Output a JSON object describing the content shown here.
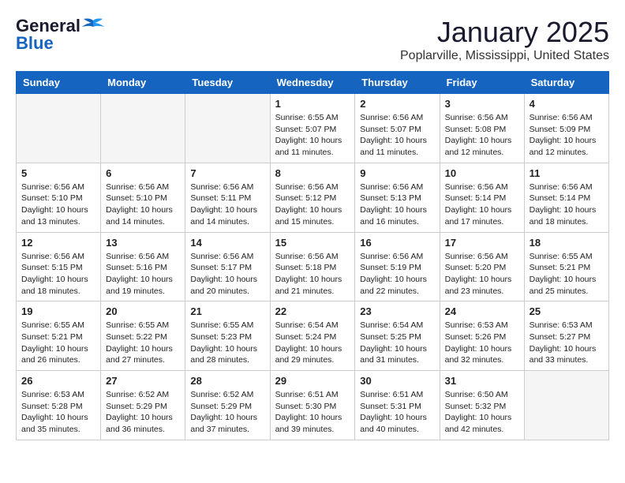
{
  "header": {
    "logo_general": "General",
    "logo_blue": "Blue",
    "title": "January 2025",
    "subtitle": "Poplarville, Mississippi, United States"
  },
  "days_of_week": [
    "Sunday",
    "Monday",
    "Tuesday",
    "Wednesday",
    "Thursday",
    "Friday",
    "Saturday"
  ],
  "weeks": [
    [
      {
        "day": "",
        "info": ""
      },
      {
        "day": "",
        "info": ""
      },
      {
        "day": "",
        "info": ""
      },
      {
        "day": "1",
        "info": "Sunrise: 6:55 AM\nSunset: 5:07 PM\nDaylight: 10 hours\nand 11 minutes."
      },
      {
        "day": "2",
        "info": "Sunrise: 6:56 AM\nSunset: 5:07 PM\nDaylight: 10 hours\nand 11 minutes."
      },
      {
        "day": "3",
        "info": "Sunrise: 6:56 AM\nSunset: 5:08 PM\nDaylight: 10 hours\nand 12 minutes."
      },
      {
        "day": "4",
        "info": "Sunrise: 6:56 AM\nSunset: 5:09 PM\nDaylight: 10 hours\nand 12 minutes."
      }
    ],
    [
      {
        "day": "5",
        "info": "Sunrise: 6:56 AM\nSunset: 5:10 PM\nDaylight: 10 hours\nand 13 minutes."
      },
      {
        "day": "6",
        "info": "Sunrise: 6:56 AM\nSunset: 5:10 PM\nDaylight: 10 hours\nand 14 minutes."
      },
      {
        "day": "7",
        "info": "Sunrise: 6:56 AM\nSunset: 5:11 PM\nDaylight: 10 hours\nand 14 minutes."
      },
      {
        "day": "8",
        "info": "Sunrise: 6:56 AM\nSunset: 5:12 PM\nDaylight: 10 hours\nand 15 minutes."
      },
      {
        "day": "9",
        "info": "Sunrise: 6:56 AM\nSunset: 5:13 PM\nDaylight: 10 hours\nand 16 minutes."
      },
      {
        "day": "10",
        "info": "Sunrise: 6:56 AM\nSunset: 5:14 PM\nDaylight: 10 hours\nand 17 minutes."
      },
      {
        "day": "11",
        "info": "Sunrise: 6:56 AM\nSunset: 5:14 PM\nDaylight: 10 hours\nand 18 minutes."
      }
    ],
    [
      {
        "day": "12",
        "info": "Sunrise: 6:56 AM\nSunset: 5:15 PM\nDaylight: 10 hours\nand 18 minutes."
      },
      {
        "day": "13",
        "info": "Sunrise: 6:56 AM\nSunset: 5:16 PM\nDaylight: 10 hours\nand 19 minutes."
      },
      {
        "day": "14",
        "info": "Sunrise: 6:56 AM\nSunset: 5:17 PM\nDaylight: 10 hours\nand 20 minutes."
      },
      {
        "day": "15",
        "info": "Sunrise: 6:56 AM\nSunset: 5:18 PM\nDaylight: 10 hours\nand 21 minutes."
      },
      {
        "day": "16",
        "info": "Sunrise: 6:56 AM\nSunset: 5:19 PM\nDaylight: 10 hours\nand 22 minutes."
      },
      {
        "day": "17",
        "info": "Sunrise: 6:56 AM\nSunset: 5:20 PM\nDaylight: 10 hours\nand 23 minutes."
      },
      {
        "day": "18",
        "info": "Sunrise: 6:55 AM\nSunset: 5:21 PM\nDaylight: 10 hours\nand 25 minutes."
      }
    ],
    [
      {
        "day": "19",
        "info": "Sunrise: 6:55 AM\nSunset: 5:21 PM\nDaylight: 10 hours\nand 26 minutes."
      },
      {
        "day": "20",
        "info": "Sunrise: 6:55 AM\nSunset: 5:22 PM\nDaylight: 10 hours\nand 27 minutes."
      },
      {
        "day": "21",
        "info": "Sunrise: 6:55 AM\nSunset: 5:23 PM\nDaylight: 10 hours\nand 28 minutes."
      },
      {
        "day": "22",
        "info": "Sunrise: 6:54 AM\nSunset: 5:24 PM\nDaylight: 10 hours\nand 29 minutes."
      },
      {
        "day": "23",
        "info": "Sunrise: 6:54 AM\nSunset: 5:25 PM\nDaylight: 10 hours\nand 31 minutes."
      },
      {
        "day": "24",
        "info": "Sunrise: 6:53 AM\nSunset: 5:26 PM\nDaylight: 10 hours\nand 32 minutes."
      },
      {
        "day": "25",
        "info": "Sunrise: 6:53 AM\nSunset: 5:27 PM\nDaylight: 10 hours\nand 33 minutes."
      }
    ],
    [
      {
        "day": "26",
        "info": "Sunrise: 6:53 AM\nSunset: 5:28 PM\nDaylight: 10 hours\nand 35 minutes."
      },
      {
        "day": "27",
        "info": "Sunrise: 6:52 AM\nSunset: 5:29 PM\nDaylight: 10 hours\nand 36 minutes."
      },
      {
        "day": "28",
        "info": "Sunrise: 6:52 AM\nSunset: 5:29 PM\nDaylight: 10 hours\nand 37 minutes."
      },
      {
        "day": "29",
        "info": "Sunrise: 6:51 AM\nSunset: 5:30 PM\nDaylight: 10 hours\nand 39 minutes."
      },
      {
        "day": "30",
        "info": "Sunrise: 6:51 AM\nSunset: 5:31 PM\nDaylight: 10 hours\nand 40 minutes."
      },
      {
        "day": "31",
        "info": "Sunrise: 6:50 AM\nSunset: 5:32 PM\nDaylight: 10 hours\nand 42 minutes."
      },
      {
        "day": "",
        "info": ""
      }
    ]
  ]
}
